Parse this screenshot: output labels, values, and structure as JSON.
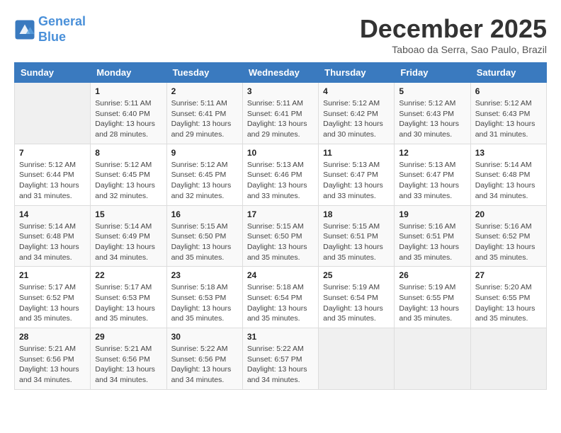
{
  "logo": {
    "line1": "General",
    "line2": "Blue"
  },
  "title": "December 2025",
  "subtitle": "Taboao da Serra, Sao Paulo, Brazil",
  "headers": [
    "Sunday",
    "Monday",
    "Tuesday",
    "Wednesday",
    "Thursday",
    "Friday",
    "Saturday"
  ],
  "weeks": [
    [
      {
        "day": "",
        "info": ""
      },
      {
        "day": "1",
        "info": "Sunrise: 5:11 AM\nSunset: 6:40 PM\nDaylight: 13 hours\nand 28 minutes."
      },
      {
        "day": "2",
        "info": "Sunrise: 5:11 AM\nSunset: 6:41 PM\nDaylight: 13 hours\nand 29 minutes."
      },
      {
        "day": "3",
        "info": "Sunrise: 5:11 AM\nSunset: 6:41 PM\nDaylight: 13 hours\nand 29 minutes."
      },
      {
        "day": "4",
        "info": "Sunrise: 5:12 AM\nSunset: 6:42 PM\nDaylight: 13 hours\nand 30 minutes."
      },
      {
        "day": "5",
        "info": "Sunrise: 5:12 AM\nSunset: 6:43 PM\nDaylight: 13 hours\nand 30 minutes."
      },
      {
        "day": "6",
        "info": "Sunrise: 5:12 AM\nSunset: 6:43 PM\nDaylight: 13 hours\nand 31 minutes."
      }
    ],
    [
      {
        "day": "7",
        "info": "Sunrise: 5:12 AM\nSunset: 6:44 PM\nDaylight: 13 hours\nand 31 minutes."
      },
      {
        "day": "8",
        "info": "Sunrise: 5:12 AM\nSunset: 6:45 PM\nDaylight: 13 hours\nand 32 minutes."
      },
      {
        "day": "9",
        "info": "Sunrise: 5:12 AM\nSunset: 6:45 PM\nDaylight: 13 hours\nand 32 minutes."
      },
      {
        "day": "10",
        "info": "Sunrise: 5:13 AM\nSunset: 6:46 PM\nDaylight: 13 hours\nand 33 minutes."
      },
      {
        "day": "11",
        "info": "Sunrise: 5:13 AM\nSunset: 6:47 PM\nDaylight: 13 hours\nand 33 minutes."
      },
      {
        "day": "12",
        "info": "Sunrise: 5:13 AM\nSunset: 6:47 PM\nDaylight: 13 hours\nand 33 minutes."
      },
      {
        "day": "13",
        "info": "Sunrise: 5:14 AM\nSunset: 6:48 PM\nDaylight: 13 hours\nand 34 minutes."
      }
    ],
    [
      {
        "day": "14",
        "info": "Sunrise: 5:14 AM\nSunset: 6:48 PM\nDaylight: 13 hours\nand 34 minutes."
      },
      {
        "day": "15",
        "info": "Sunrise: 5:14 AM\nSunset: 6:49 PM\nDaylight: 13 hours\nand 34 minutes."
      },
      {
        "day": "16",
        "info": "Sunrise: 5:15 AM\nSunset: 6:50 PM\nDaylight: 13 hours\nand 35 minutes."
      },
      {
        "day": "17",
        "info": "Sunrise: 5:15 AM\nSunset: 6:50 PM\nDaylight: 13 hours\nand 35 minutes."
      },
      {
        "day": "18",
        "info": "Sunrise: 5:15 AM\nSunset: 6:51 PM\nDaylight: 13 hours\nand 35 minutes."
      },
      {
        "day": "19",
        "info": "Sunrise: 5:16 AM\nSunset: 6:51 PM\nDaylight: 13 hours\nand 35 minutes."
      },
      {
        "day": "20",
        "info": "Sunrise: 5:16 AM\nSunset: 6:52 PM\nDaylight: 13 hours\nand 35 minutes."
      }
    ],
    [
      {
        "day": "21",
        "info": "Sunrise: 5:17 AM\nSunset: 6:52 PM\nDaylight: 13 hours\nand 35 minutes."
      },
      {
        "day": "22",
        "info": "Sunrise: 5:17 AM\nSunset: 6:53 PM\nDaylight: 13 hours\nand 35 minutes."
      },
      {
        "day": "23",
        "info": "Sunrise: 5:18 AM\nSunset: 6:53 PM\nDaylight: 13 hours\nand 35 minutes."
      },
      {
        "day": "24",
        "info": "Sunrise: 5:18 AM\nSunset: 6:54 PM\nDaylight: 13 hours\nand 35 minutes."
      },
      {
        "day": "25",
        "info": "Sunrise: 5:19 AM\nSunset: 6:54 PM\nDaylight: 13 hours\nand 35 minutes."
      },
      {
        "day": "26",
        "info": "Sunrise: 5:19 AM\nSunset: 6:55 PM\nDaylight: 13 hours\nand 35 minutes."
      },
      {
        "day": "27",
        "info": "Sunrise: 5:20 AM\nSunset: 6:55 PM\nDaylight: 13 hours\nand 35 minutes."
      }
    ],
    [
      {
        "day": "28",
        "info": "Sunrise: 5:21 AM\nSunset: 6:56 PM\nDaylight: 13 hours\nand 34 minutes."
      },
      {
        "day": "29",
        "info": "Sunrise: 5:21 AM\nSunset: 6:56 PM\nDaylight: 13 hours\nand 34 minutes."
      },
      {
        "day": "30",
        "info": "Sunrise: 5:22 AM\nSunset: 6:56 PM\nDaylight: 13 hours\nand 34 minutes."
      },
      {
        "day": "31",
        "info": "Sunrise: 5:22 AM\nSunset: 6:57 PM\nDaylight: 13 hours\nand 34 minutes."
      },
      {
        "day": "",
        "info": ""
      },
      {
        "day": "",
        "info": ""
      },
      {
        "day": "",
        "info": ""
      }
    ]
  ]
}
